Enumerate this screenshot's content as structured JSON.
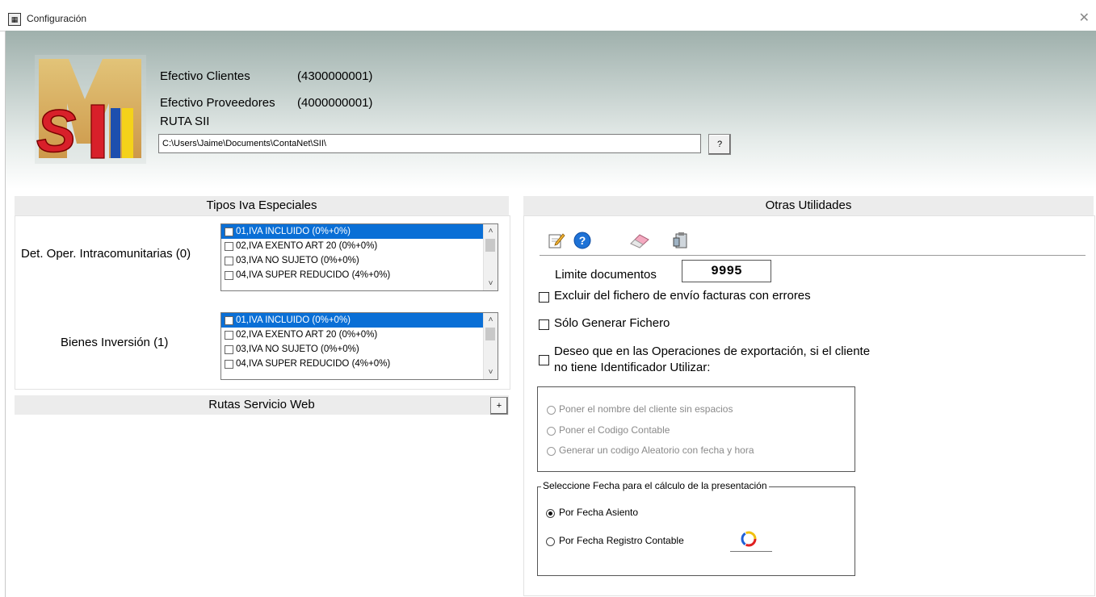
{
  "window": {
    "title": "Configuración"
  },
  "header": {
    "logo_text": "SII",
    "efectivo_clientes_label": "Efectivo Clientes",
    "efectivo_clientes_value": "(4300000001)",
    "efectivo_proveedores_label": "Efectivo Proveedores",
    "efectivo_proveedores_value": "(4000000001)",
    "ruta_label": "RUTA SII",
    "ruta_value": "C:\\Users\\Jaime\\Documents\\ContaNet\\SII\\",
    "browse_label": "?"
  },
  "tipos_iva": {
    "title": "Tipos Iva Especiales",
    "intracom_label": "Det. Oper. Intracomunitarias (0)",
    "bienes_label": "Bienes Inversión (1)",
    "options": [
      "01,IVA INCLUIDO (0%+0%)",
      "02,IVA EXENTO ART 20 (0%+0%)",
      "03,IVA NO SUJETO (0%+0%)",
      "04,IVA SUPER REDUCIDO (4%+0%)"
    ],
    "selected_index": 0
  },
  "rutas": {
    "title": "Rutas Servicio Web",
    "expand_label": "+"
  },
  "otras": {
    "title": "Otras Utilidades",
    "toolbar": [
      "edit-icon",
      "help-icon",
      "eraser-icon",
      "clipboard-icon"
    ],
    "limite_label": "Limite documentos",
    "limite_value": "9995",
    "excluir_label": "Excluir del fichero de envío facturas con errores",
    "solo_label": "Sólo Generar Fichero",
    "deseo_line1": "Deseo que en las Operaciones de exportación, si el cliente",
    "deseo_line2": "no tiene Identificador Utilizar:",
    "export_options": [
      "Poner el nombre del cliente sin espacios",
      "Poner el Codigo Contable",
      "Generar un codigo Aleatorio con fecha y hora"
    ],
    "fecha_group_title": "Seleccione Fecha para el cálculo de la presentación",
    "fecha_options": [
      "Por Fecha Asiento",
      "Por Fecha Registro Contable"
    ],
    "fecha_selected": 0
  }
}
